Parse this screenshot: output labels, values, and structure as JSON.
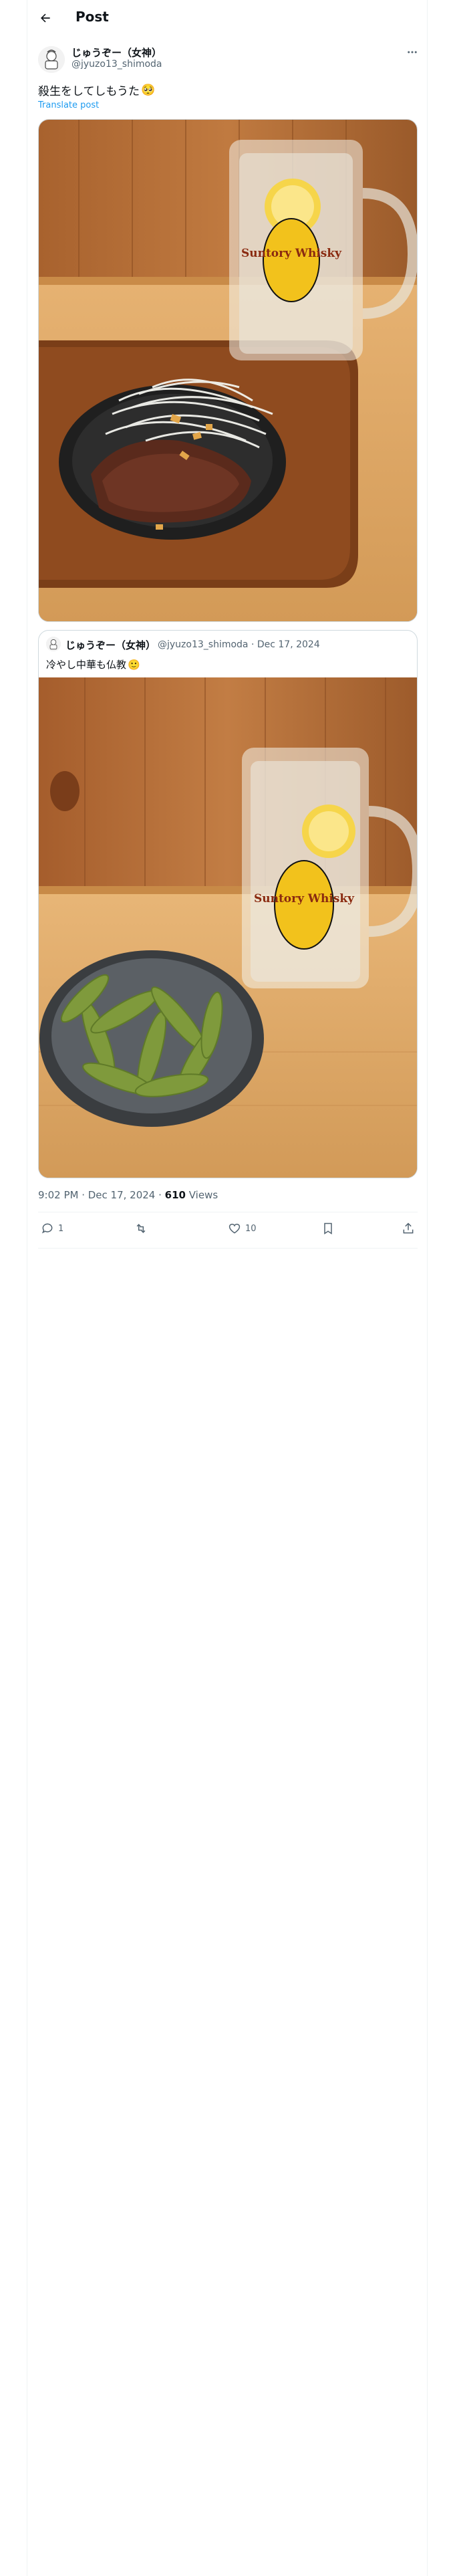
{
  "header": {
    "title": "Post"
  },
  "post": {
    "display_name": "じゅうぞー（女神）",
    "handle": "@jyuzo13_shimoda",
    "text": "殺生をしてしもうた",
    "emoji": "🥺",
    "translate_label": "Translate post",
    "timestamp": "9:02 PM · Dec 17, 2024 · ",
    "views_count": "610",
    "views_label": " Views",
    "reply_count": "1",
    "repost_count": "",
    "like_count": "10"
  },
  "quote": {
    "display_name": "じゅうぞー（女神）",
    "meta": "@jyuzo13_shimoda · Dec 17, 2024",
    "text": "冷やし中華も仏教",
    "emoji": "🙂"
  },
  "media": {
    "image1_label": "Suntory Whisky",
    "image2_label": "Suntory Whisky"
  },
  "colors": {
    "accent": "#1d9bf0",
    "secondary_text": "#536471",
    "border": "#cfd9de"
  }
}
